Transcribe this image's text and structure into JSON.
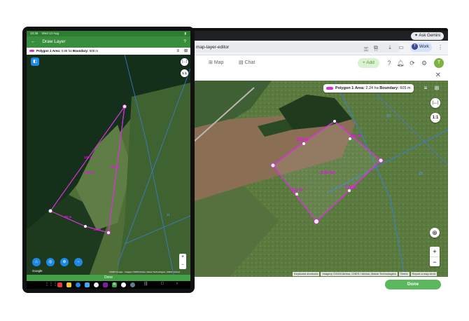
{
  "browser": {
    "ask_gemini": "Ask Gemini",
    "url": "map-layer-editor",
    "profile_label": "Work",
    "profile_initial": "T"
  },
  "app": {
    "nav_map": "Map",
    "nav_chat": "Chat",
    "add_label": "Add",
    "user_initial": "T",
    "done_label": "Done"
  },
  "desktop_map": {
    "polygon_name": "Polygon 1",
    "area_label": "Area:",
    "area_value": "2.24 ha",
    "boundary_label": "Boundary:",
    "boundary_value": "605 m",
    "edge_labels": [
      "156 m",
      "122 m",
      "151 m",
      "176 m"
    ],
    "center_label": "2.24 ha",
    "paddock_numbers": [
      "30",
      "29"
    ],
    "btn_ruler": "|↔|",
    "btn_scale": "1:1",
    "zoom_in": "+",
    "zoom_out": "−",
    "attrib_shortcuts": "Keyboard shortcuts",
    "attrib_imagery": "Imagery ©2025 Airbus, CNES / Airbus, Maxar Technologies",
    "attrib_terms": "Terms",
    "attrib_report": "Report a map error"
  },
  "tablet": {
    "status_time": "10:38",
    "status_date": "Wed 13 Aug",
    "title": "Draw Layer",
    "polygon_name": "Polygon 1",
    "area_label": "Area:",
    "area_value": "0.86 ha",
    "boundary_label": "Boundary:",
    "boundary_value": "505 m",
    "edge_labels": [
      "120 m",
      "265 m",
      "60 m",
      "28 m"
    ],
    "center_label": "0.86 ha",
    "paddock_number": "31",
    "btn_scale": "1:1",
    "google_label": "Google",
    "attribution": "©2025 Google · Imagery ©2025 Airbus, Maxar Technologies, CNES / Airbus",
    "done_label": "Done"
  },
  "colors": {
    "polygon": "#d633d6",
    "paddock_line": "#3b7dd8",
    "primary_green": "#43a047"
  }
}
